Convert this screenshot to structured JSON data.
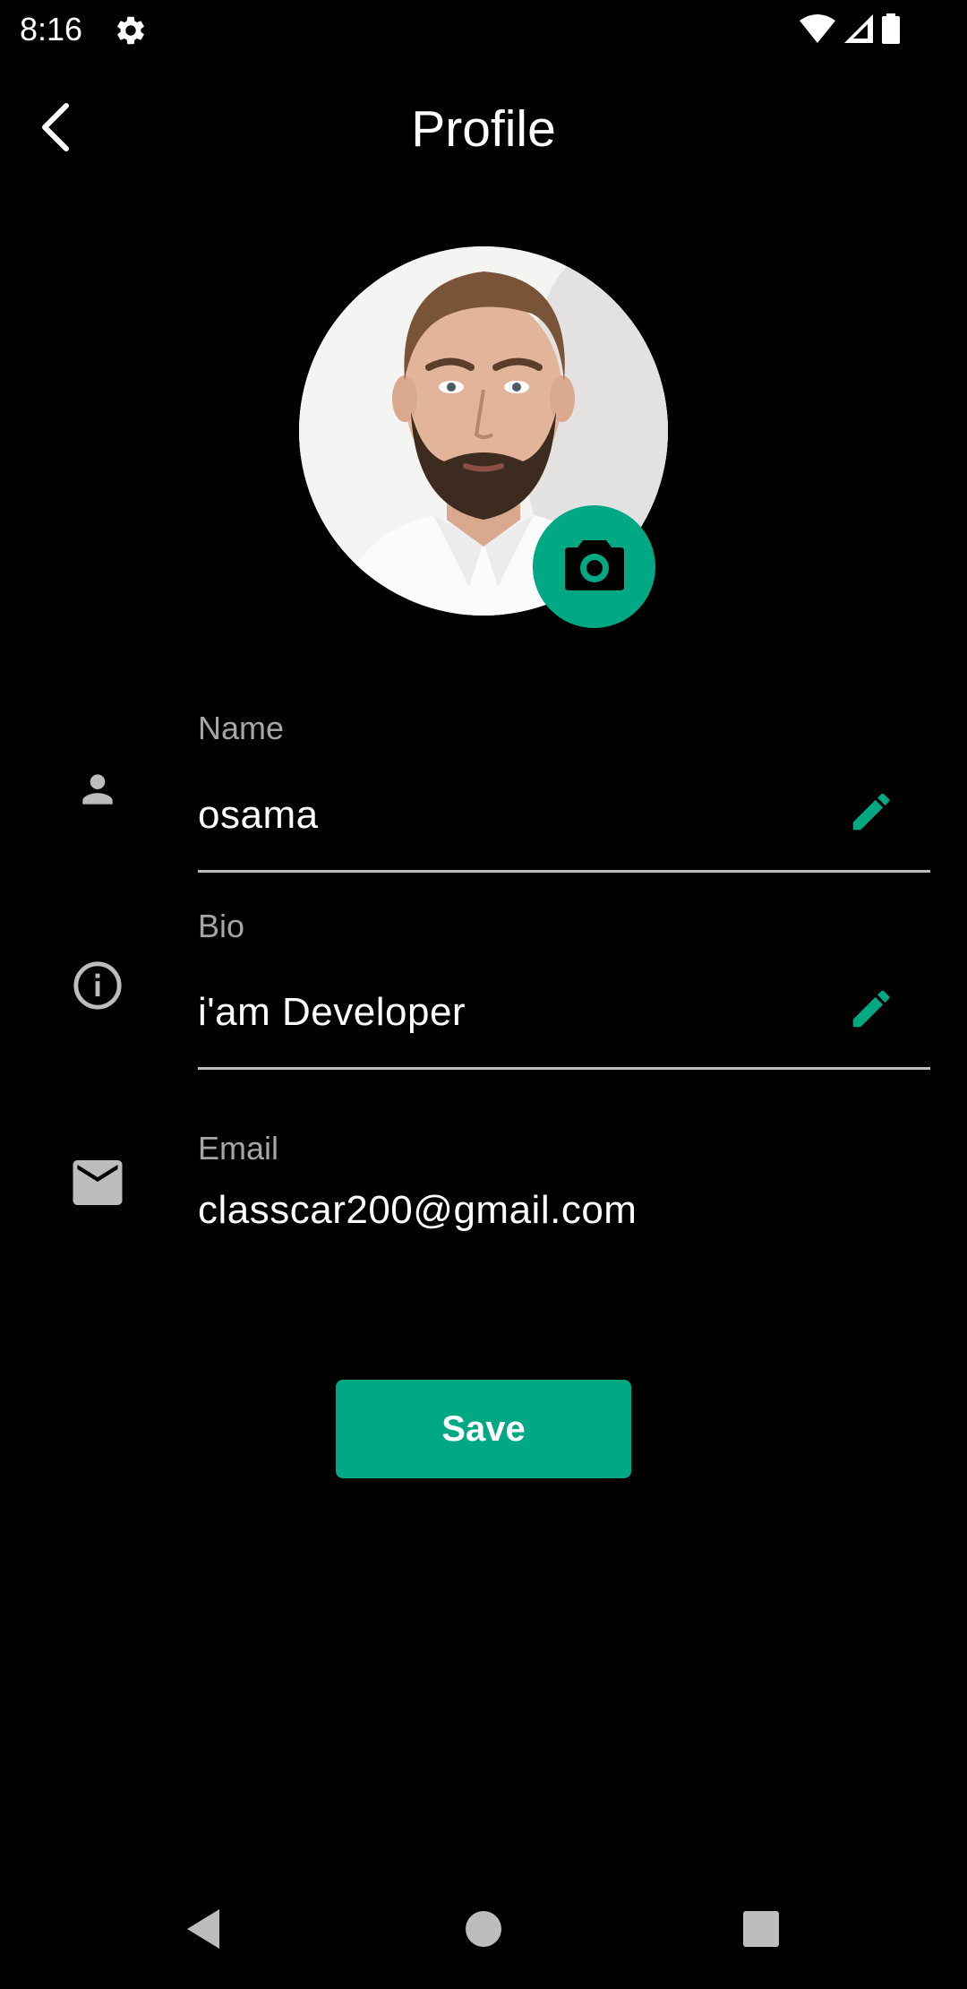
{
  "status_bar": {
    "time": "8:16",
    "icons": [
      "settings-icon",
      "wifi-icon",
      "signal-icon",
      "battery-icon"
    ]
  },
  "app_bar": {
    "title": "Profile",
    "back_icon": "chevron-left-icon"
  },
  "profile": {
    "camera_icon": "camera-icon",
    "fields": [
      {
        "label": "Name",
        "value": "osama",
        "icon": "person-icon",
        "editable": true
      },
      {
        "label": "Bio",
        "value": "i'am Developer",
        "icon": "info-icon",
        "editable": true
      },
      {
        "label": "Email",
        "value": "classcar200@gmail.com",
        "icon": "mail-icon",
        "editable": false
      }
    ]
  },
  "actions": {
    "save_label": "Save"
  },
  "nav_bar": {
    "icons": [
      "back-triangle-icon",
      "home-circle-icon",
      "recents-square-icon"
    ]
  },
  "colors": {
    "background": "#000000",
    "accent": "#00A884",
    "text_primary": "#FFFFFF",
    "text_secondary": "#A6A6A6",
    "divider": "#BDBDBD",
    "icon_grey": "#BDBDBD"
  }
}
